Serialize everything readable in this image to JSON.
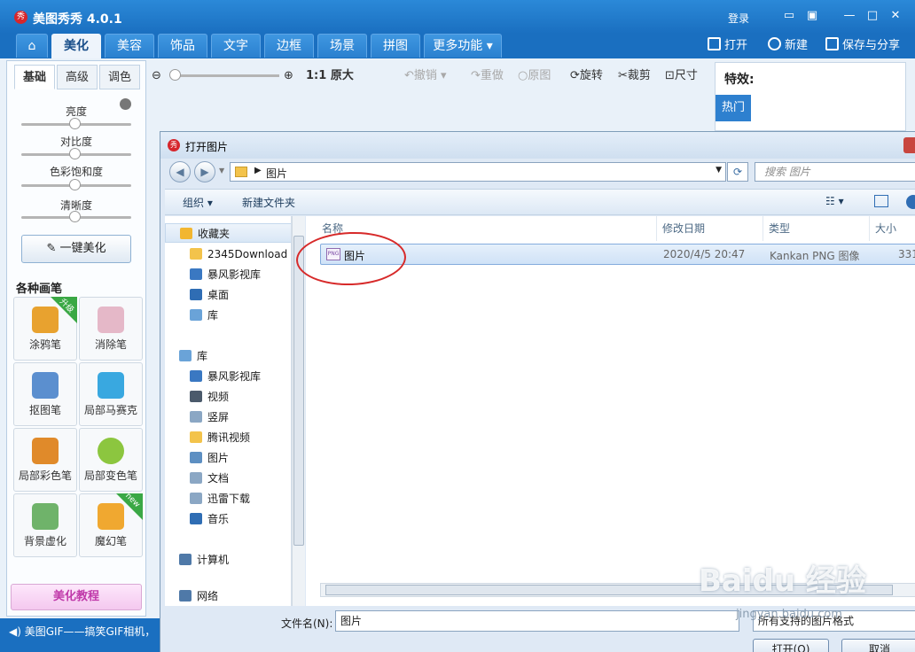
{
  "app": {
    "title": "美图秀秀 4.0.1",
    "logo_text": "秀",
    "login": "登录"
  },
  "menu_tabs": [
    "美化",
    "美容",
    "饰品",
    "文字",
    "边框",
    "场景",
    "拼图",
    "更多功能"
  ],
  "top_actions": {
    "open": "打开",
    "new": "新建",
    "save_share": "保存与分享"
  },
  "left_panel": {
    "subtabs": [
      "基础",
      "高级",
      "调色"
    ],
    "sliders": [
      "亮度",
      "对比度",
      "色彩饱和度",
      "清晰度"
    ],
    "one_key": "一键美化",
    "brushes_title": "各种画笔",
    "brushes": [
      "涂鸦笔",
      "消除笔",
      "抠图笔",
      "局部马赛克",
      "局部彩色笔",
      "局部变色笔",
      "背景虚化",
      "魔幻笔"
    ],
    "badge_upgrade": "升级",
    "badge_new": "new",
    "tutorial": "美化教程"
  },
  "status_bar": "美图GIF——搞笑GIF相机，",
  "toolbar": {
    "original_size": "1:1 原大",
    "undo": "撤销",
    "redo": "重做",
    "original": "原图",
    "rotate": "旋转",
    "crop": "裁剪",
    "size": "尺寸"
  },
  "effects": {
    "title": "特效:",
    "hot": "热门"
  },
  "dialog": {
    "title": "打开图片",
    "address": "图片",
    "search_placeholder": "搜索 图片",
    "cmd_organize": "组织 ▾",
    "cmd_new_folder": "新建文件夹",
    "nav_items": [
      {
        "label": "收藏夹",
        "icon": "star-icon",
        "color": "#f2b630"
      },
      {
        "label": "2345Download",
        "icon": "folder-icon",
        "color": "#f3c34b"
      },
      {
        "label": "暴风影视库",
        "icon": "library-icon",
        "color": "#3a78c2"
      },
      {
        "label": "桌面",
        "icon": "desktop-icon",
        "color": "#2f6db4"
      },
      {
        "label": "库",
        "icon": "library-folder-icon",
        "color": "#6aa3d8"
      },
      {
        "label": "库",
        "icon": "library-folder-icon",
        "color": "#6aa3d8"
      },
      {
        "label": "暴风影视库",
        "icon": "library-icon",
        "color": "#3a78c2"
      },
      {
        "label": "视频",
        "icon": "video-icon",
        "color": "#4b5a6b"
      },
      {
        "label": "竖屏",
        "icon": "document-icon",
        "color": "#8ba7c4"
      },
      {
        "label": "腾讯视频",
        "icon": "folder-icon",
        "color": "#f3c34b"
      },
      {
        "label": "图片",
        "icon": "picture-icon",
        "color": "#5d8fc2"
      },
      {
        "label": "文档",
        "icon": "document-icon",
        "color": "#8ba7c4"
      },
      {
        "label": "迅雷下载",
        "icon": "document-icon",
        "color": "#8ba7c4"
      },
      {
        "label": "音乐",
        "icon": "music-icon",
        "color": "#2f6db4"
      },
      {
        "label": "计算机",
        "icon": "computer-icon",
        "color": "#4f79a8"
      },
      {
        "label": "网络",
        "icon": "network-icon",
        "color": "#4f79a8"
      }
    ],
    "columns": [
      "名称",
      "修改日期",
      "类型",
      "大小"
    ],
    "files": [
      {
        "name": "图片",
        "modified": "2020/4/5 20:47",
        "type": "Kankan PNG 图像",
        "size": "331"
      }
    ],
    "filename_label": "文件名(N):",
    "filename_value": "图片",
    "filter": "所有支持的图片格式",
    "open_button": "打开(O)",
    "cancel_button": "取消",
    "png_label": "PNG"
  },
  "watermark": {
    "main": "Baidu 经验",
    "sub": "jingyan.baidu.com"
  }
}
